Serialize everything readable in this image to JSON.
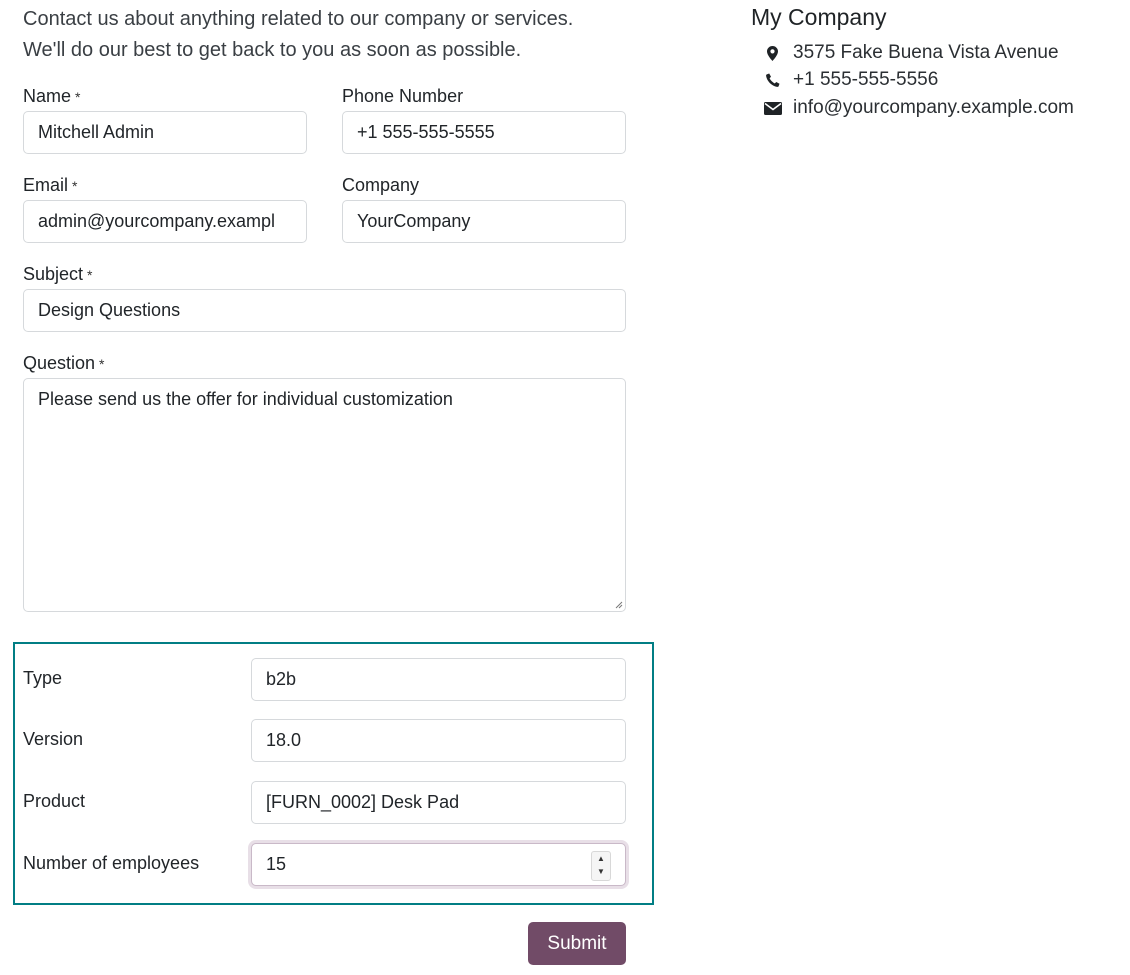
{
  "intro": {
    "line1": "Contact us about anything related to our company or services.",
    "line2": "We'll do our best to get back to you as soon as possible."
  },
  "required_marker": "*",
  "form": {
    "name": {
      "label": "Name",
      "value": "Mitchell Admin"
    },
    "phone": {
      "label": "Phone Number",
      "value": "+1 555-555-5555"
    },
    "email": {
      "label": "Email",
      "value": "admin@yourcompany.exampl"
    },
    "company": {
      "label": "Company",
      "value": "YourCompany"
    },
    "subject": {
      "label": "Subject",
      "value": "Design Questions"
    },
    "question": {
      "label": "Question",
      "value": "Please send us the offer for individual customization"
    },
    "type": {
      "label": "Type",
      "value": "b2b"
    },
    "version": {
      "label": "Version",
      "value": "18.0"
    },
    "product": {
      "label": "Product",
      "value": "[FURN_0002] Desk Pad"
    },
    "employees": {
      "label": "Number of employees",
      "value": "15"
    },
    "submit_label": "Submit"
  },
  "company_info": {
    "name": "My Company",
    "address": "3575 Fake Buena Vista Avenue",
    "phone": "+1 555-555-5556",
    "email": "info@yourcompany.example.com",
    "icons": [
      "map-marker-icon",
      "phone-icon",
      "envelope-icon"
    ]
  },
  "colors": {
    "accent": "#714b67",
    "section_border": "#017e84",
    "input_border": "#d6d9dc"
  }
}
